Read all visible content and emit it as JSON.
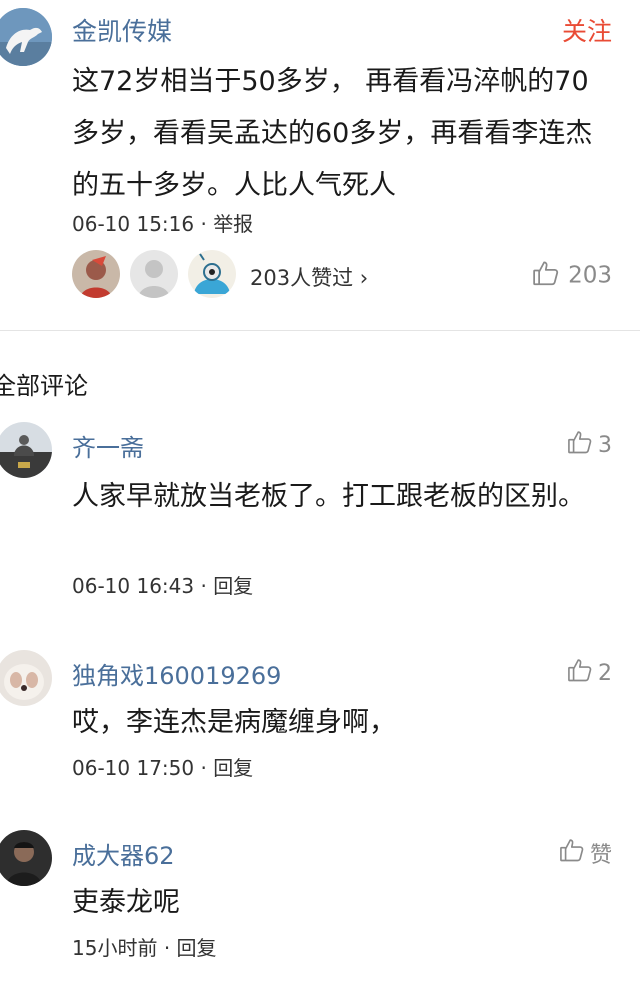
{
  "post": {
    "username": "金凯传媒",
    "follow_label": "关注",
    "body": "这72岁相当于50多岁， 再看看冯淬帆的70多岁，看看吴孟达的60多岁，再看看李连杰的五十多岁。人比人气死人",
    "time": "06-10 15:16",
    "sep": "·",
    "report_label": "举报",
    "likers_text": "203人赞过",
    "likers_chevron": "›",
    "like_count": "203"
  },
  "section": {
    "title": "全部评论"
  },
  "comments": [
    {
      "username": "齐一斋",
      "like": "3",
      "text": "人家早就放当老板了。打工跟老板的区别。",
      "time": "06-10 16:43",
      "sep": "·",
      "reply_label": "回复"
    },
    {
      "username": "独角戏160019269",
      "like": "2",
      "text": "哎，李连杰是病魔缠身啊，",
      "time": "06-10 17:50",
      "sep": "·",
      "reply_label": "回复"
    },
    {
      "username": "成大器62",
      "like": "赞",
      "text": "吏泰龙呢",
      "time": "15小时前",
      "sep": "·",
      "reply_label": "回复"
    }
  ],
  "icons": {
    "thumb": "thumbs-up-icon",
    "chevron": "chevron-right-icon"
  },
  "colors": {
    "username": "#4a6f9a",
    "follow": "#e94b35",
    "meta": "#8a8a8a"
  }
}
